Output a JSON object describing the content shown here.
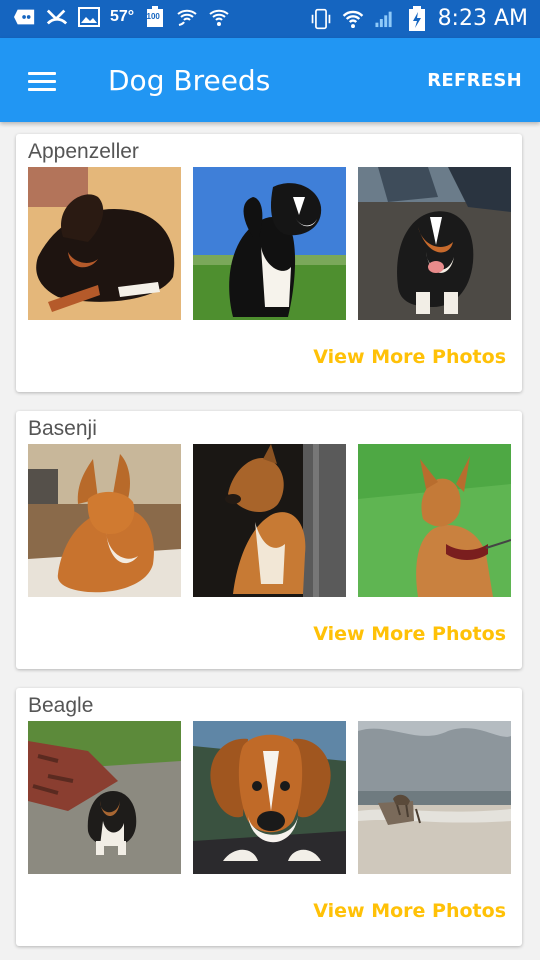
{
  "status_bar": {
    "temperature": "57°",
    "battery_small": "100",
    "time": "8:23 AM"
  },
  "app_bar": {
    "title": "Dog Breeds",
    "refresh_label": "REFRESH"
  },
  "breeds": [
    {
      "name": "Appenzeller",
      "view_more_label": "View More Photos"
    },
    {
      "name": "Basenji",
      "view_more_label": "View More Photos"
    },
    {
      "name": "Beagle",
      "view_more_label": "View More Photos"
    }
  ],
  "colors": {
    "status_bar": "#1565c0",
    "app_bar": "#2196f3",
    "accent": "#ffc107"
  }
}
